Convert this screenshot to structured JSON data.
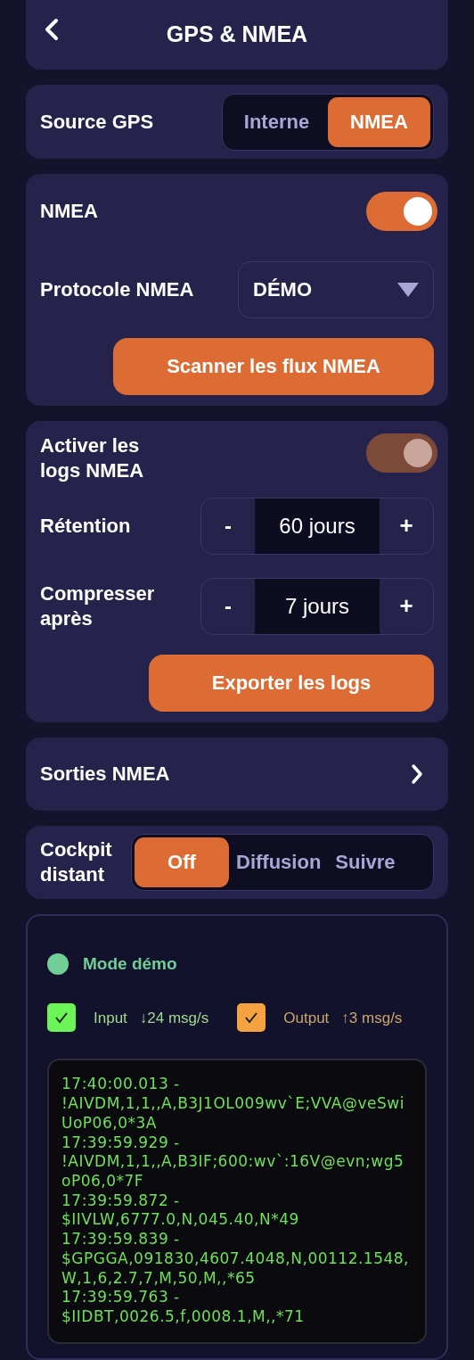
{
  "header": {
    "title": "GPS & NMEA"
  },
  "gps_source": {
    "label": "Source GPS",
    "options": [
      {
        "label": "Interne",
        "selected": false
      },
      {
        "label": "NMEA",
        "selected": true
      }
    ]
  },
  "nmea": {
    "label": "NMEA",
    "on": true,
    "protocol_label": "Protocole NMEA",
    "protocol_value": "DÉMO",
    "scan_button": "Scanner les flux NMEA"
  },
  "logs": {
    "label": "Activer les logs NMEA",
    "on": true,
    "disabled": true,
    "steppers": [
      {
        "label": "Rétention",
        "minus": "-",
        "value": "60 jours",
        "plus": "+"
      },
      {
        "label": "Compresser après",
        "minus": "-",
        "value": "7 jours",
        "plus": "+"
      }
    ],
    "export_button": "Exporter les logs"
  },
  "outputs": {
    "label": "Sorties NMEA"
  },
  "remote_cockpit": {
    "label": "Cockpit distant",
    "options": [
      {
        "label": "Off",
        "selected": true
      },
      {
        "label": "Diffusion",
        "selected": false
      },
      {
        "label": "Suivre",
        "selected": false
      }
    ]
  },
  "monitor": {
    "status": {
      "label": "Mode démo",
      "color": "#6fcf97"
    },
    "filters": [
      {
        "label": "Input",
        "rate": "↓24 msg/s",
        "checked": true,
        "color": "#6cf556"
      },
      {
        "label": "Output",
        "rate": "↑3 msg/s",
        "checked": true,
        "color": "#f4a340"
      }
    ],
    "log_lines": [
      "17:40:00.013 - !AIVDM,1,1,,A,B3J1OL009wv`E;VVA@veSwiUoP06,0*3A",
      "17:39:59.929 - !AIVDM,1,1,,A,B3IF;600:wv`:16V@evn;wg5oP06,0*7F",
      "17:39:59.872 - $IIVLW,6777.0,N,045.40,N*49",
      "17:39:59.839 - $GPGGA,091830,4607.4048,N,00112.1548,W,1,6,2.7,7,M,50,M,,*65",
      "17:39:59.763 - $IIDBT,0026.5,f,0008.1,M,,*71"
    ]
  }
}
